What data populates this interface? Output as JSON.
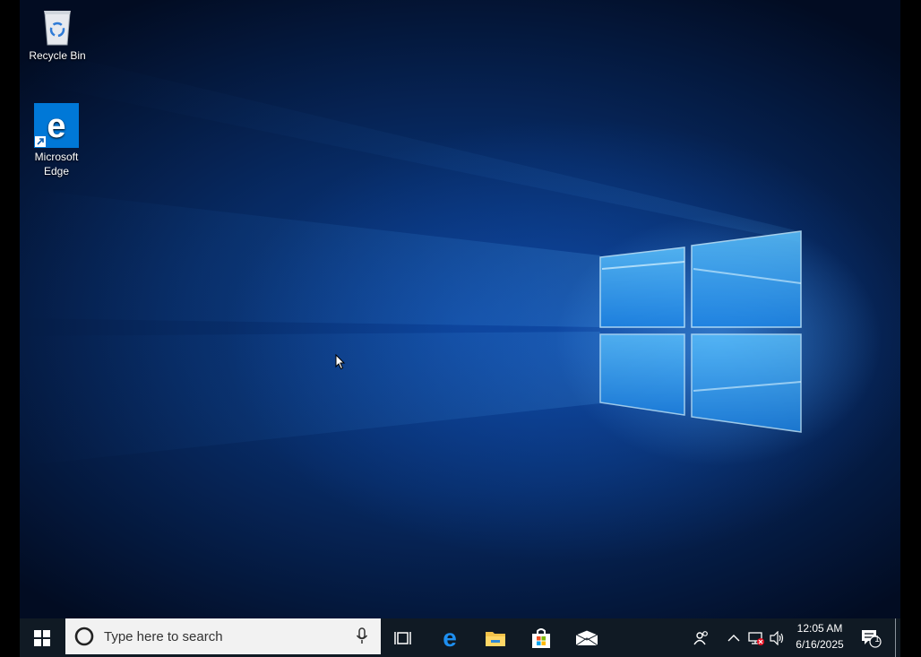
{
  "desktop": {
    "icons": [
      {
        "label": "Recycle Bin",
        "icon": "recycle-bin-icon"
      },
      {
        "label": "Microsoft Edge",
        "icon": "edge-icon"
      }
    ]
  },
  "taskbar": {
    "start_icon": "windows-logo-icon",
    "search_placeholder": "Type here to search",
    "search_icon": "cortana-circle-icon",
    "mic_icon": "microphone-icon",
    "pinned": [
      {
        "name": "Task View",
        "icon": "task-view-icon"
      },
      {
        "name": "Microsoft Edge",
        "icon": "edge-icon"
      },
      {
        "name": "File Explorer",
        "icon": "folder-icon"
      },
      {
        "name": "Microsoft Store",
        "icon": "store-bag-icon"
      },
      {
        "name": "Mail",
        "icon": "mail-icon"
      }
    ],
    "tray": {
      "people_icon": "people-icon",
      "chevron_icon": "chevron-up-icon",
      "network_icon": "network-disconnected-icon",
      "volume_icon": "volume-icon",
      "time": "12:05 AM",
      "date": "6/16/2025",
      "notification_icon": "action-center-icon",
      "notification_count": "1"
    }
  },
  "colors": {
    "taskbar": "#101a24",
    "accent": "#0078d7",
    "light": "#7fd0ff"
  }
}
